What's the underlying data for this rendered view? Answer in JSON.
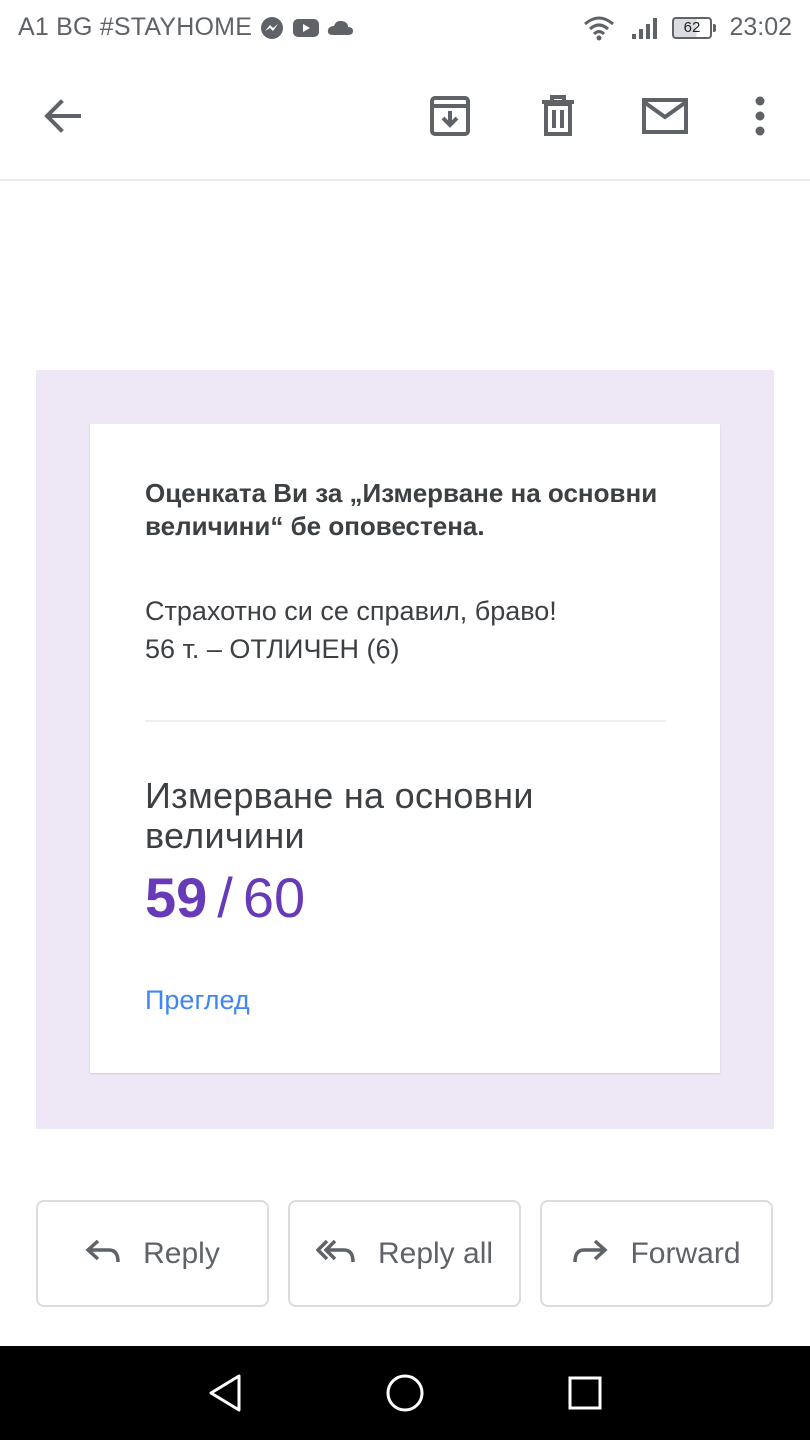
{
  "status_bar": {
    "carrier": "A1 BG #STAYHOME",
    "battery": "62",
    "time": "23:02",
    "icons": [
      "messenger-icon",
      "youtube-icon",
      "cloud-icon",
      "wifi-icon",
      "signal-icon",
      "battery-icon"
    ]
  },
  "toolbar": {
    "icons": [
      "back-arrow-icon",
      "archive-icon",
      "delete-icon",
      "mark-unread-icon",
      "more-vert-icon"
    ]
  },
  "email": {
    "headline": "Оценката Ви за „Измерване на основни величини“ бе оповестена.",
    "message_line1": "Страхотно си се справил, браво!",
    "message_line2": "56 т. – ОТЛИЧЕН (6)",
    "assignment_title": "Измерване на основни величини",
    "score": "59",
    "score_separator": "/",
    "max_score": "60",
    "review_link": "Преглед"
  },
  "actions": {
    "reply": "Reply",
    "reply_all": "Reply all",
    "forward": "Forward"
  },
  "nav_bar": {
    "icons": [
      "nav-back-icon",
      "nav-home-icon",
      "nav-recents-icon"
    ]
  },
  "colors": {
    "accent": "#673ab7",
    "outer_background": "#ede7f6",
    "link": "#4285f4"
  }
}
